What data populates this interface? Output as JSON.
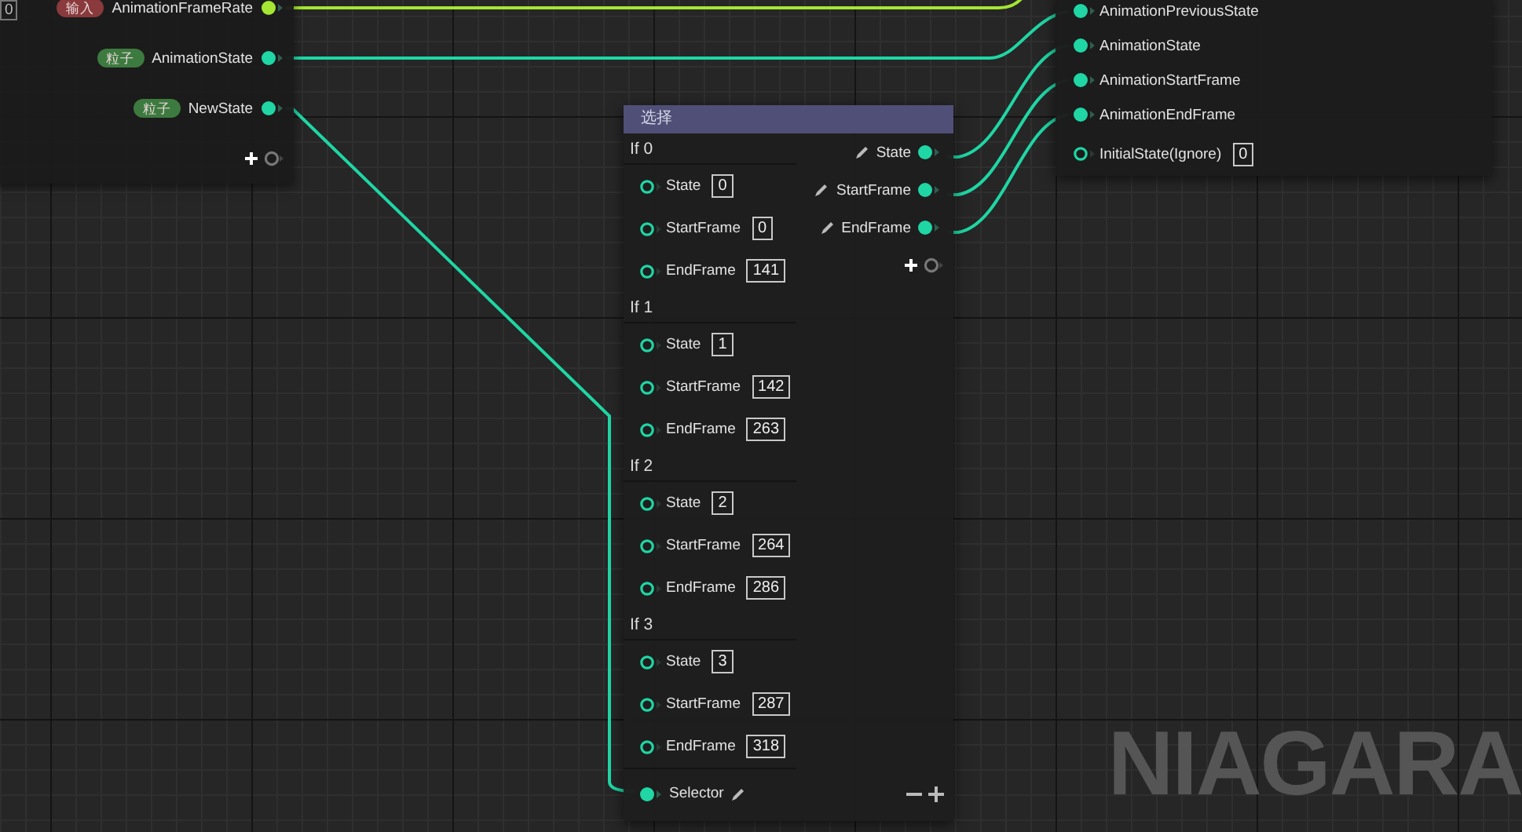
{
  "left_node": {
    "cut_value": "0",
    "pins": [
      {
        "tag": {
          "text": "输入",
          "color": "#8a3a3c"
        },
        "label": "AnimationFrameRate",
        "color": "#a4e633",
        "connected": true
      },
      {
        "tag": {
          "text": "粒子",
          "color": "#3d7a3f"
        },
        "label": "AnimationState",
        "color": "#1fd6a4",
        "connected": true
      },
      {
        "tag": {
          "text": "粒子",
          "color": "#3d7a3f"
        },
        "label": "NewState",
        "color": "#1fd6a4",
        "connected": true
      }
    ]
  },
  "select_node": {
    "title": "选择",
    "cases": [
      {
        "label": "If 0",
        "inputs": [
          {
            "label": "State",
            "value": "0",
            "connected": false
          },
          {
            "label": "StartFrame",
            "value": "0",
            "connected": false
          },
          {
            "label": "EndFrame",
            "value": "141",
            "connected": false
          }
        ]
      },
      {
        "label": "If 1",
        "inputs": [
          {
            "label": "State",
            "value": "1",
            "connected": false
          },
          {
            "label": "StartFrame",
            "value": "142",
            "connected": false
          },
          {
            "label": "EndFrame",
            "value": "263",
            "connected": false
          }
        ]
      },
      {
        "label": "If 2",
        "inputs": [
          {
            "label": "State",
            "value": "2",
            "connected": false
          },
          {
            "label": "StartFrame",
            "value": "264",
            "connected": false
          },
          {
            "label": "EndFrame",
            "value": "286",
            "connected": false
          }
        ]
      },
      {
        "label": "If 3",
        "inputs": [
          {
            "label": "State",
            "value": "3",
            "connected": false
          },
          {
            "label": "StartFrame",
            "value": "287",
            "connected": false
          },
          {
            "label": "EndFrame",
            "value": "318",
            "connected": false
          }
        ]
      }
    ],
    "outputs": [
      {
        "label": "State",
        "connected": true
      },
      {
        "label": "StartFrame",
        "connected": true
      },
      {
        "label": "EndFrame",
        "connected": true
      }
    ],
    "selector": {
      "label": "Selector",
      "connected": true
    }
  },
  "output_node": {
    "pins": [
      {
        "label": "AnimationPreviousState",
        "connected": true
      },
      {
        "label": "AnimationState",
        "connected": true
      },
      {
        "label": "AnimationStartFrame",
        "connected": true
      },
      {
        "label": "AnimationEndFrame",
        "connected": true
      },
      {
        "label": "InitialState(Ignore)",
        "connected": false,
        "value": "0"
      }
    ]
  },
  "graph_label": "NIAGARA"
}
